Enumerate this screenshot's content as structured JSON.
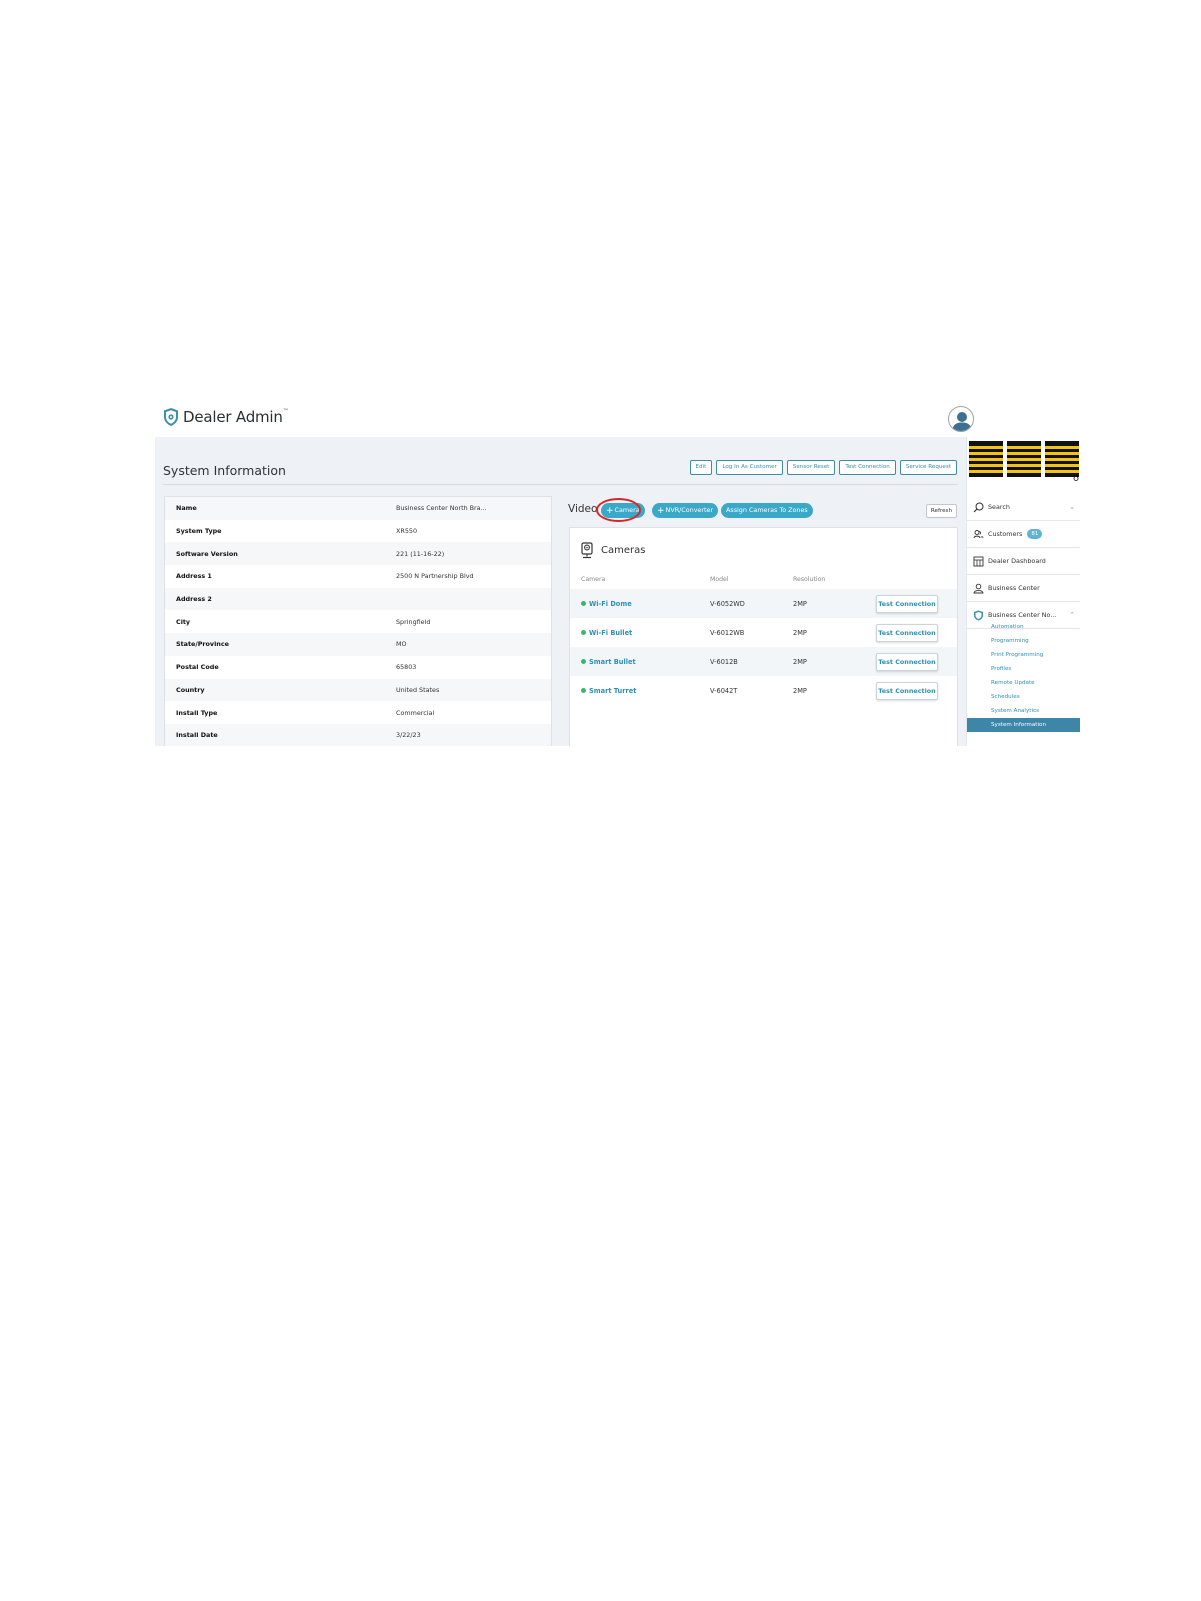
{
  "header": {
    "brand": "Dealer Admin",
    "brand_mark": "™"
  },
  "page": {
    "title": "System Information",
    "actions": [
      "Edit",
      "Log In As Customer",
      "Sensor Reset",
      "Test Connection",
      "Service Request"
    ]
  },
  "system_info": [
    {
      "label": "Name",
      "value": "Business Center North Bra..."
    },
    {
      "label": "System Type",
      "value": "XR550"
    },
    {
      "label": "Software Version",
      "value": "221 (11-16-22)"
    },
    {
      "label": "Address 1",
      "value": "2500 N Partnership Blvd"
    },
    {
      "label": "Address 2",
      "value": ""
    },
    {
      "label": "City",
      "value": "Springfield"
    },
    {
      "label": "State/Province",
      "value": "MO"
    },
    {
      "label": "Postal Code",
      "value": "65803"
    },
    {
      "label": "Country",
      "value": "United States"
    },
    {
      "label": "Install Type",
      "value": "Commercial"
    },
    {
      "label": "Install Date",
      "value": "3/22/23"
    }
  ],
  "video": {
    "label": "Video",
    "plus": "+",
    "add_camera": "Camera",
    "add_nvr": "NVR/Converter",
    "assign": "Assign Cameras To Zones",
    "refresh": "Refresh"
  },
  "cameras": {
    "title": "Cameras",
    "columns": {
      "camera": "Camera",
      "model": "Model",
      "resolution": "Resolution"
    },
    "test_label": "Test Connection",
    "rows": [
      {
        "name": "Wi-Fi Dome",
        "model": "V-6052WD",
        "resolution": "2MP"
      },
      {
        "name": "Wi-Fi Bullet",
        "model": "V-6012WB",
        "resolution": "2MP"
      },
      {
        "name": "Smart Bullet",
        "model": "V-6012B",
        "resolution": "2MP"
      },
      {
        "name": "Smart Turret",
        "model": "V-6042T",
        "resolution": "2MP"
      }
    ]
  },
  "sidebar": {
    "logo": "DMP",
    "search": "Search",
    "customers": "Customers",
    "customers_count": "81",
    "dealer_dashboard": "Dealer Dashboard",
    "business_center": "Business Center",
    "current_system": "Business Center No...",
    "sub_items": [
      "Automation",
      "Programming",
      "Print Programming",
      "Profiles",
      "Remote Update",
      "Schedules",
      "System Analytics",
      "System Information"
    ]
  },
  "colors": {
    "accent": "#3aa8c8",
    "link": "#2e8fb3",
    "highlight": "#d6262b",
    "status_online": "#39b76e",
    "active_nav": "#3d86a7",
    "logo_yellow": "#f2c31a"
  }
}
